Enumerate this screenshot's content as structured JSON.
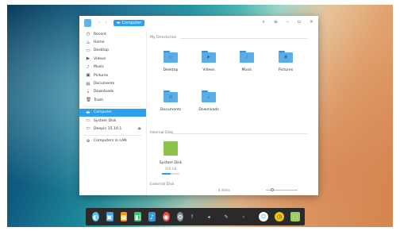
{
  "toolbar": {
    "breadcrumb": "Computer",
    "back_icon": "chevron-left-icon",
    "forward_icon": "chevron-right-icon",
    "search_icon": "search-icon",
    "menu_icon": "menu-icon",
    "minimize_icon": "minimize-icon",
    "maximize_icon": "maximize-icon",
    "close_icon": "close-icon"
  },
  "sidebar": {
    "items": [
      {
        "label": "Recent",
        "icon": "clock-icon",
        "glyph": "◷"
      },
      {
        "label": "Home",
        "icon": "home-icon",
        "glyph": "⌂"
      },
      {
        "label": "Desktop",
        "icon": "desktop-icon",
        "glyph": "▭"
      },
      {
        "label": "Videos",
        "icon": "video-icon",
        "glyph": "▶"
      },
      {
        "label": "Music",
        "icon": "music-icon",
        "glyph": "♪"
      },
      {
        "label": "Pictures",
        "icon": "picture-icon",
        "glyph": "▣"
      },
      {
        "label": "Documents",
        "icon": "document-icon",
        "glyph": "▤"
      },
      {
        "label": "Downloads",
        "icon": "download-icon",
        "glyph": "⤓"
      },
      {
        "label": "Trash",
        "icon": "trash-icon",
        "glyph": "🗑"
      },
      {
        "label": "Computer",
        "icon": "computer-icon",
        "glyph": "▬",
        "active": true
      },
      {
        "label": "System Disk",
        "icon": "disk-icon",
        "glyph": "▭"
      },
      {
        "label": "Deepin 15.10.1",
        "icon": "disk-icon",
        "glyph": "▭",
        "eject": "⏏"
      },
      {
        "label": "Computers in LAN",
        "icon": "network-icon",
        "glyph": "⊕"
      }
    ]
  },
  "main": {
    "my_directories_label": "My Directories",
    "folders": [
      {
        "label": "Desktop",
        "glyph": "▭"
      },
      {
        "label": "Videos",
        "glyph": "▶"
      },
      {
        "label": "Music",
        "glyph": "♪"
      },
      {
        "label": "Pictures",
        "glyph": "▣"
      },
      {
        "label": "Documents",
        "glyph": "▤"
      },
      {
        "label": "Downloads",
        "glyph": "⤓"
      }
    ],
    "internal_disk_label": "Internal Disk",
    "disk": {
      "name": "System Disk",
      "size": "160 GB",
      "usage_fraction": 0.5
    },
    "removable_disk_label": "External Disk",
    "status_count": "8 items"
  },
  "dock": {
    "apps": [
      {
        "name": "launcher-icon",
        "color": "#5bc0eb",
        "glyph": "◐"
      },
      {
        "name": "file-manager-icon",
        "color": "#4aa3df",
        "glyph": "▣"
      },
      {
        "name": "app-store-icon",
        "color": "#f39c12",
        "glyph": "▦"
      },
      {
        "name": "store-bag-icon",
        "color": "#2ecc71",
        "glyph": "◧"
      },
      {
        "name": "music-app-icon",
        "color": "#3498db",
        "glyph": "♪"
      },
      {
        "name": "chrome-icon",
        "color": "#e74c3c",
        "glyph": "◉"
      },
      {
        "name": "settings-icon",
        "color": "#7f8c8d",
        "glyph": "⚙"
      }
    ],
    "tray": [
      {
        "name": "help-icon",
        "glyph": "?"
      },
      {
        "name": "volume-icon",
        "glyph": "◂"
      },
      {
        "name": "pen-icon",
        "glyph": "✎"
      },
      {
        "name": "expand-icon",
        "glyph": "‹"
      }
    ],
    "power_glyph": "⏻",
    "trash_glyph": "⬚"
  }
}
